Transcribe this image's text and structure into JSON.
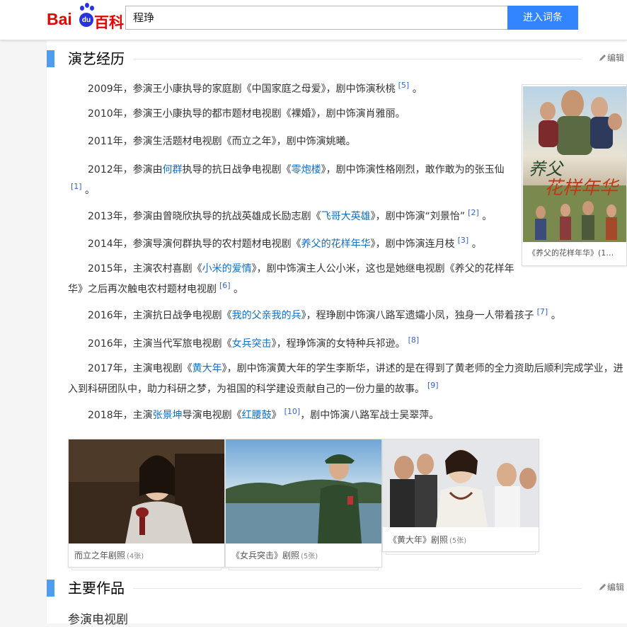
{
  "header": {
    "logo_bai": "Bai",
    "logo_du": "du",
    "logo_baike": "百科",
    "search_value": "程琤",
    "search_button": "进入词条"
  },
  "section1": {
    "title": "演艺经历",
    "edit": "编辑",
    "paragraphs": [
      {
        "pre": "2009年，参演王小康执导的家庭剧《中国家庭之母爱》，剧中饰演秋桃",
        "ref": "[5]",
        "post": "。"
      },
      {
        "pre": "2010年，参演王小康执导的都市题材电视剧《裸婚》，剧中饰演肖雅丽。"
      },
      {
        "pre": "2011年，参演生活题材电视剧《而立之年》，剧中饰演姚曦。"
      },
      {
        "pre": "2012年，参演由",
        "link1": "何群",
        "mid1": "执导的抗日战争电视剧《",
        "link2": "零炮楼",
        "mid2": "》，剧中饰演性格刚烈，敢作敢为的张玉仙",
        "ref": "[1]",
        "post": "。"
      },
      {
        "pre": "2013年，参演由曾晓欣执导的抗战英雄成长励志剧《",
        "link1": "飞哥大英雄",
        "mid1": "》，剧中饰演“刘景怡”",
        "ref": "[2]",
        "post": "。"
      },
      {
        "pre": "2014年，参演导演何群执导的农村题材电视剧《",
        "link1": "养父的花样年华",
        "mid1": "》，剧中饰演连月枝",
        "ref": "[3]",
        "post": "。"
      },
      {
        "pre": "2015年，主演农村喜剧《",
        "link1": "小米的爱情",
        "mid1": "》，剧中饰演主人公小米，这也是她继电视剧《养父的花样年华》之后再次触电农村题材电视剧",
        "ref": "[6]",
        "post": "。"
      },
      {
        "pre": "2016年，主演抗日战争电视剧《",
        "link1": "我的父亲我的兵",
        "mid1": "》，程琤剧中饰演八路军遗孀小凤，独身一人带着孩子",
        "ref": "[7]",
        "post": "。"
      },
      {
        "pre": "2016年，主演当代军旅电视剧《",
        "link1": "女兵突击",
        "mid1": "》，程琤饰演的女特种兵祁逊。",
        "ref": "[8]"
      },
      {
        "pre": "2017年，主演电视剧《",
        "link1": "黄大年",
        "mid1": "》，剧中饰演黄大年的学生李斯华，讲述的是在得到了黄老师的全力资助后顺利完成学业，进入到科研团队中，助力科研之梦，为祖国的科学建设贡献自己的一份力量的故事。",
        "ref": "[9]"
      },
      {
        "pre": "2018年，主演",
        "link1": "张景坤",
        "mid1": "导演电视剧《",
        "link2": "红腰鼓",
        "mid2": "》",
        "ref": "[10]",
        "post": "，剧中饰演八路军战士吴翠萍。"
      }
    ],
    "side_caption": "《养父的花样年华》(1…",
    "gallery": [
      {
        "caption": "而立之年剧照",
        "count": "(4张)"
      },
      {
        "caption": "《女兵突击》剧照",
        "count": "(5张)"
      },
      {
        "caption": "《黄大年》剧照",
        "count": "(5张)"
      }
    ]
  },
  "section2": {
    "title": "主要作品",
    "edit": "编辑",
    "subheading": "参演电视剧"
  },
  "icons": [
    "pencil-icon",
    "baidu-paw-icon"
  ],
  "colors": {
    "accent": "#3385ff",
    "section_bar": "#4f9cee",
    "link": "#136ec2",
    "logo_red": "#e10602",
    "logo_blue": "#2932e1"
  }
}
